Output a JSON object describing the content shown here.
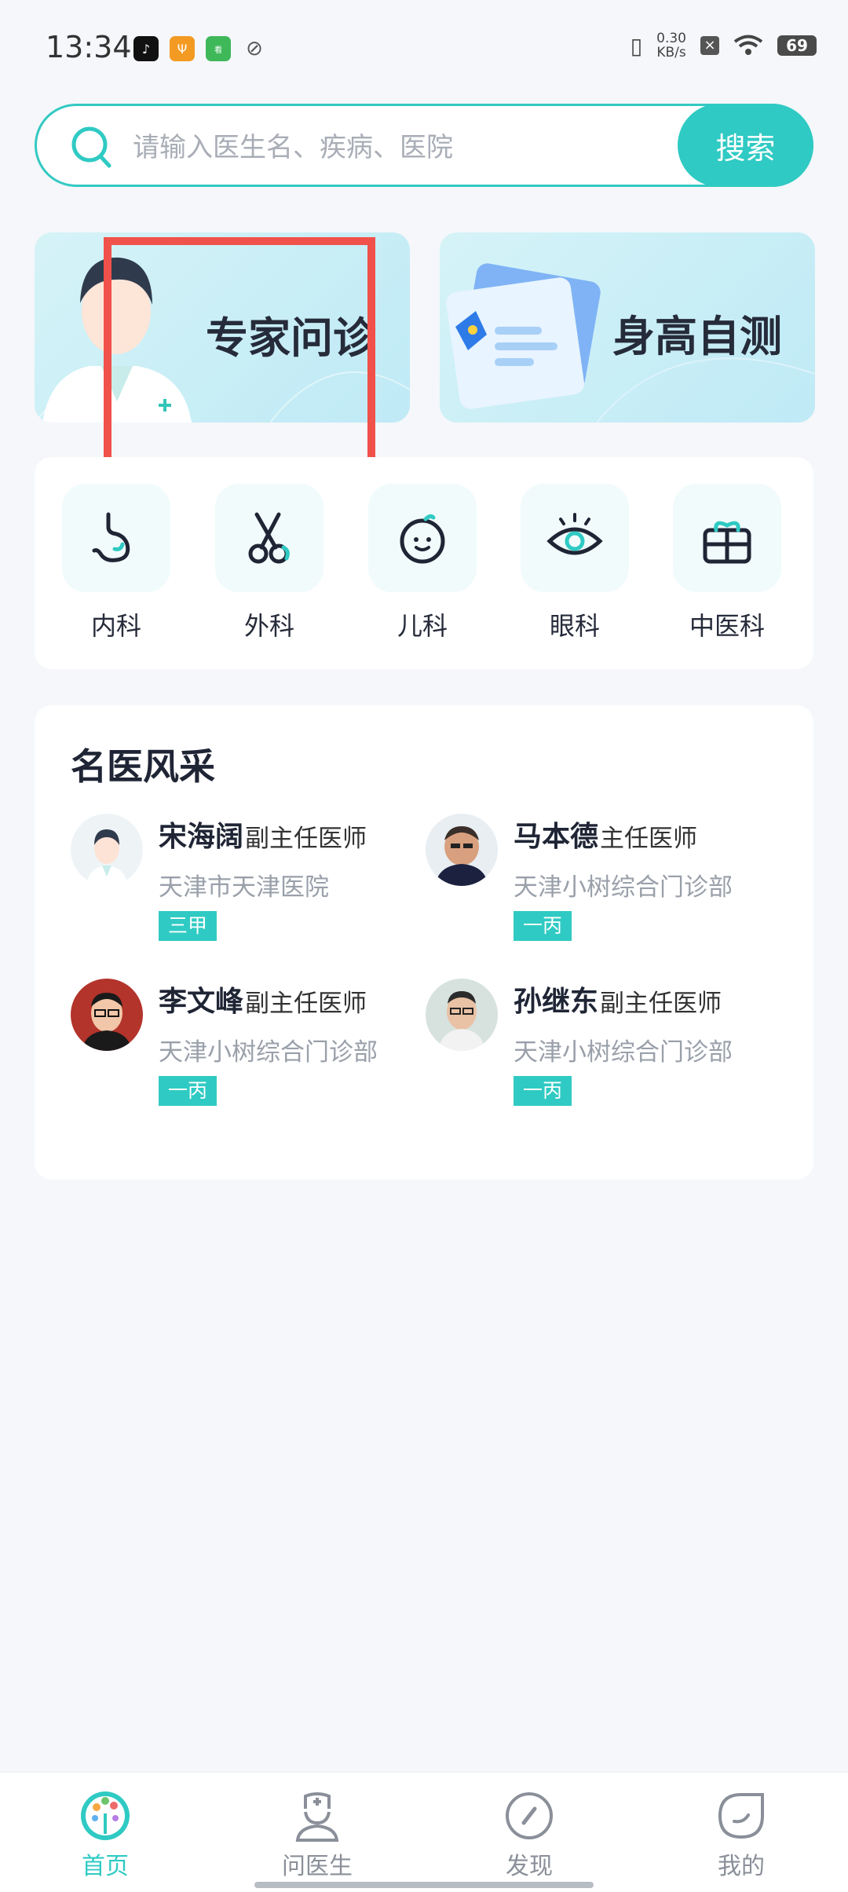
{
  "status_bar": {
    "time": "13:34",
    "net_speed_value": "0.30",
    "net_speed_unit": "KB/s",
    "battery": "69"
  },
  "search": {
    "placeholder": "请输入医生名、疾病、医院",
    "button_label": "搜索"
  },
  "banners": [
    {
      "title": "专家问诊",
      "icon": "doctor-illustration"
    },
    {
      "title": "身高自测",
      "icon": "report-illustration"
    }
  ],
  "departments": [
    {
      "label": "内科",
      "icon": "stomach-icon"
    },
    {
      "label": "外科",
      "icon": "scissors-icon"
    },
    {
      "label": "儿科",
      "icon": "baby-face-icon"
    },
    {
      "label": "眼科",
      "icon": "eye-icon"
    },
    {
      "label": "中医科",
      "icon": "gift-box-icon"
    }
  ],
  "famous_doctors": {
    "title": "名医风采",
    "doctors": [
      {
        "name": "宋海阔",
        "title": "副主任医师",
        "hospital": "天津市天津医院",
        "grade": "三甲"
      },
      {
        "name": "马本德",
        "title": "主任医师",
        "hospital": "天津小树综合门诊部",
        "grade": "一丙"
      },
      {
        "name": "李文峰",
        "title": "副主任医师",
        "hospital": "天津小树综合门诊部",
        "grade": "一丙"
      },
      {
        "name": "孙继东",
        "title": "副主任医师",
        "hospital": "天津小树综合门诊部",
        "grade": "一丙"
      }
    ]
  },
  "bottom_nav": [
    {
      "label": "首页",
      "icon": "home-tree-icon",
      "active": true
    },
    {
      "label": "问医生",
      "icon": "nurse-icon",
      "active": false
    },
    {
      "label": "发现",
      "icon": "compass-icon",
      "active": false
    },
    {
      "label": "我的",
      "icon": "profile-icon",
      "active": false
    }
  ],
  "colors": {
    "accent": "#2fcac3",
    "highlight_box": "#f0514a",
    "background": "#f5f7fb"
  }
}
